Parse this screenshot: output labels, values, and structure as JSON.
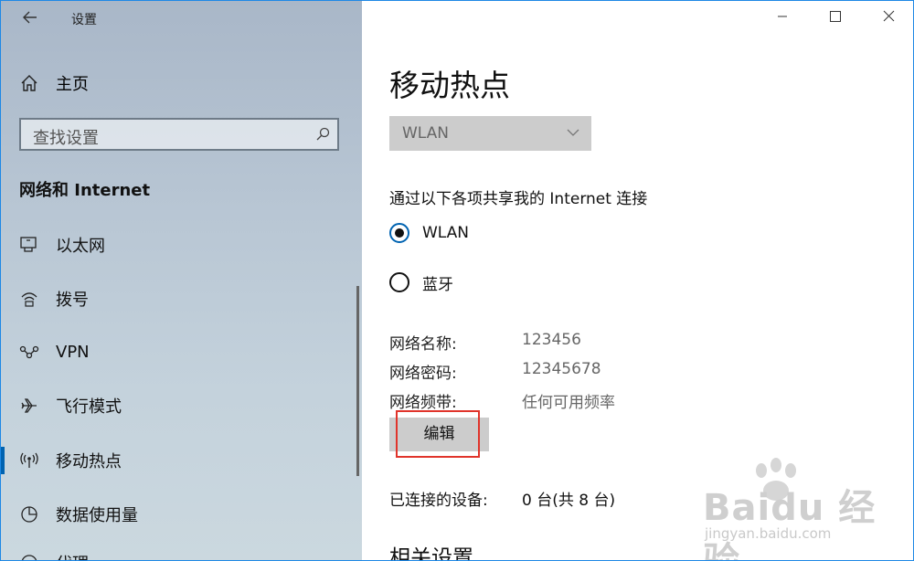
{
  "app": {
    "title": "设置"
  },
  "sidebar": {
    "home": "主页",
    "search_placeholder": "查找设置",
    "section": "网络和 Internet",
    "items": [
      {
        "label": "以太网",
        "icon": "ethernet-icon"
      },
      {
        "label": "拨号",
        "icon": "dialup-icon"
      },
      {
        "label": "VPN",
        "icon": "vpn-icon"
      },
      {
        "label": "飞行模式",
        "icon": "airplane-icon"
      },
      {
        "label": "移动热点",
        "icon": "hotspot-icon",
        "active": true
      },
      {
        "label": "数据使用量",
        "icon": "data-usage-icon"
      },
      {
        "label": "代理",
        "icon": "proxy-icon"
      }
    ]
  },
  "main": {
    "title": "移动热点",
    "dropdown_value": "WLAN",
    "share_label": "通过以下各项共享我的 Internet 连接",
    "radios": [
      {
        "label": "WLAN",
        "selected": true
      },
      {
        "label": "蓝牙",
        "selected": false
      }
    ],
    "info": {
      "name_label": "网络名称:",
      "name_value": "123456",
      "password_label": "网络密码:",
      "password_value": "12345678",
      "band_label": "网络频带:",
      "band_value": "任何可用频率"
    },
    "edit_button": "编辑",
    "devices_label": "已连接的设备:",
    "devices_value": "0 台(共 8 台)",
    "related_title": "相关设置"
  },
  "watermark": {
    "brand": "Baidu 经验",
    "url": "jingyan.baidu.com"
  },
  "colors": {
    "accent": "#0063b1",
    "highlight": "#e0342b"
  }
}
